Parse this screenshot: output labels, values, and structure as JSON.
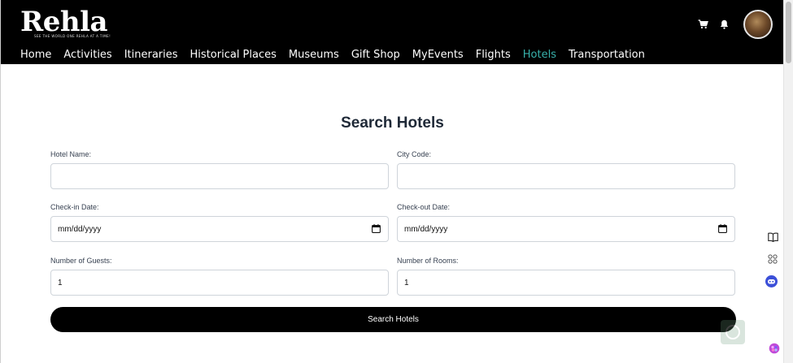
{
  "header": {
    "logo_text": "Rehla",
    "logo_tagline": "SEE THE WORLD ONE REHLA AT A TIME!",
    "nav": [
      {
        "label": "Home",
        "active": false
      },
      {
        "label": "Activities",
        "active": false
      },
      {
        "label": "Itineraries",
        "active": false
      },
      {
        "label": "Historical Places",
        "active": false
      },
      {
        "label": "Museums",
        "active": false
      },
      {
        "label": "Gift Shop",
        "active": false
      },
      {
        "label": "MyEvents",
        "active": false
      },
      {
        "label": "Flights",
        "active": false
      },
      {
        "label": "Hotels",
        "active": true
      },
      {
        "label": "Transportation",
        "active": false
      }
    ],
    "icons": [
      "cart-icon",
      "bell-icon"
    ]
  },
  "main": {
    "title": "Search Hotels",
    "fields": {
      "hotel_name": {
        "label": "Hotel Name:",
        "value": ""
      },
      "city_code": {
        "label": "City Code:",
        "value": ""
      },
      "check_in": {
        "label": "Check-in Date:",
        "value": "mm/dd/yyyy"
      },
      "check_out": {
        "label": "Check-out Date:",
        "value": "mm/dd/yyyy"
      },
      "guests": {
        "label": "Number of Guests:",
        "value": "1"
      },
      "rooms": {
        "label": "Number of Rooms:",
        "value": "1"
      }
    },
    "search_button": "Search Hotels"
  },
  "side_tools": [
    "book-icon",
    "apps-icon",
    "assistant-icon",
    "brain-icon"
  ],
  "colors": {
    "header_bg": "#000000",
    "active_nav": "#38b2ac",
    "button_bg": "#000000"
  }
}
